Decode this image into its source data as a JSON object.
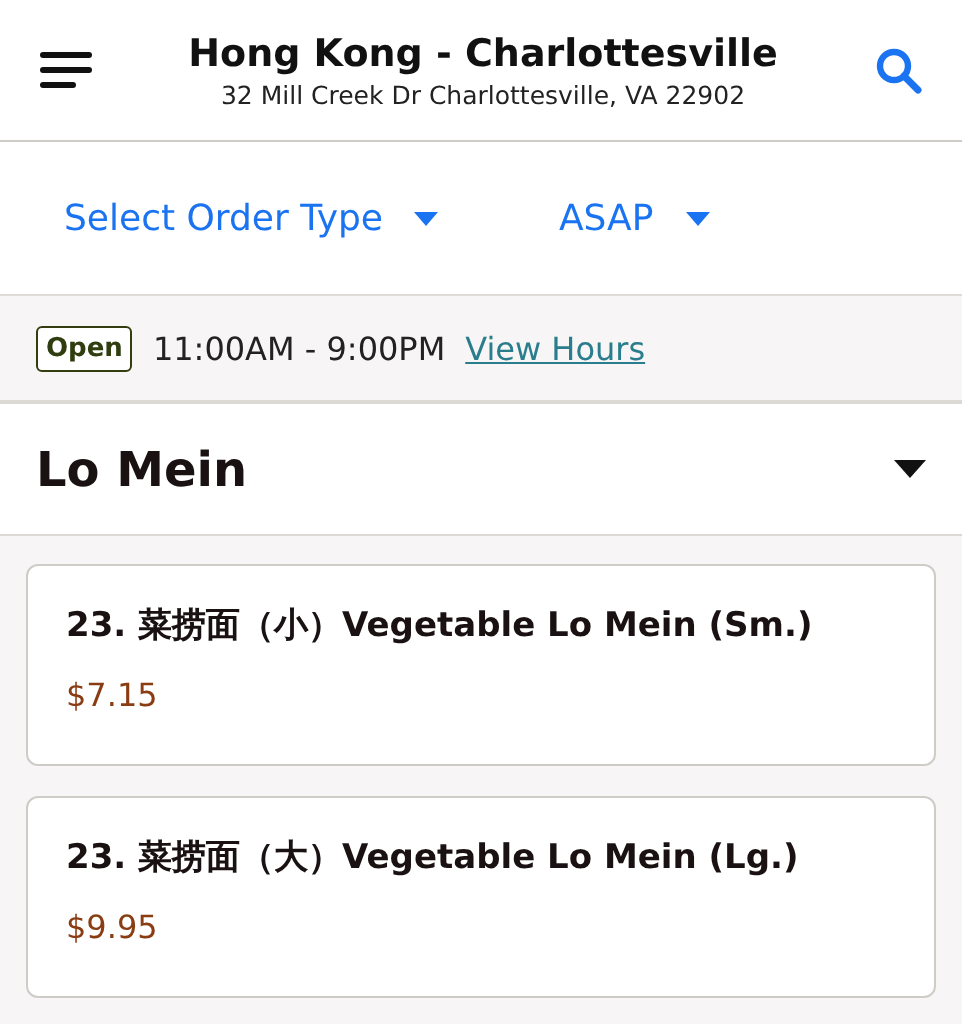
{
  "header": {
    "title": "Hong Kong - Charlottesville",
    "address": "32 Mill Creek Dr Charlottesville, VA 22902"
  },
  "selectors": [
    {
      "label": "Select Order Type"
    },
    {
      "label": "ASAP"
    }
  ],
  "hours": {
    "status": "Open",
    "time": "11:00AM - 9:00PM",
    "link": "View Hours"
  },
  "category": {
    "name": "Lo Mein",
    "expanded": true
  },
  "items": [
    {
      "name": "23. 菜捞面（小）Vegetable Lo Mein (Sm.)",
      "price": "$7.15"
    },
    {
      "name": "23. 菜捞面（大）Vegetable Lo Mein (Lg.)",
      "price": "$9.95"
    }
  ]
}
